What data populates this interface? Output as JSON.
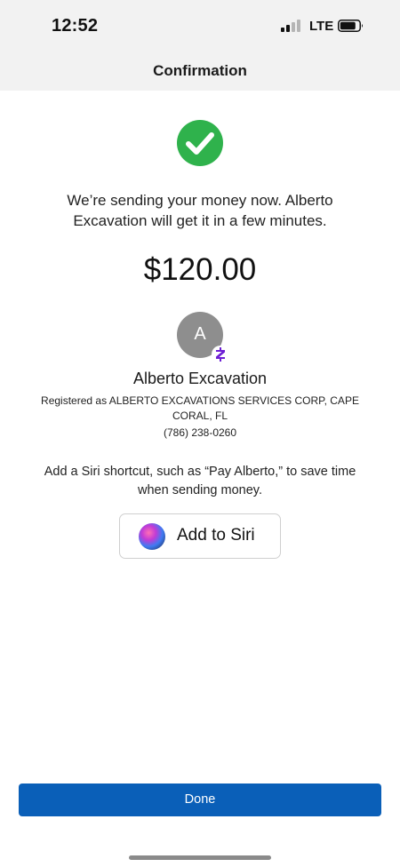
{
  "status_bar": {
    "time": "12:52",
    "carrier": "LTE",
    "signal_icon": "cellular-signal-icon",
    "battery_icon": "battery-icon"
  },
  "header": {
    "title": "Confirmation"
  },
  "confirmation": {
    "icon": "check-circle-icon",
    "icon_color": "#2fb24c",
    "message_line1": "We’re sending your money now. Alberto",
    "message_line2": "Excavation  will get it in a few minutes.",
    "amount": "$120.00"
  },
  "recipient": {
    "avatar_initial": "A",
    "avatar_color": "#8e8e8e",
    "badge_icon": "zelle-icon",
    "badge_color": "#6d1ed4",
    "name": "Alberto Excavation",
    "registered_line1": "Registered as ALBERTO EXCAVATIONS SERVICES CORP, CAPE",
    "registered_line2": "CORAL, FL",
    "phone": "(786) 238-0260"
  },
  "siri": {
    "note_line1": "Add a Siri shortcut, such as “Pay Alberto,” to save time",
    "note_line2": "when sending money.",
    "button_label": "Add to Siri",
    "icon": "siri-icon"
  },
  "footer": {
    "done_label": "Done",
    "done_color": "#0a5fb8"
  }
}
